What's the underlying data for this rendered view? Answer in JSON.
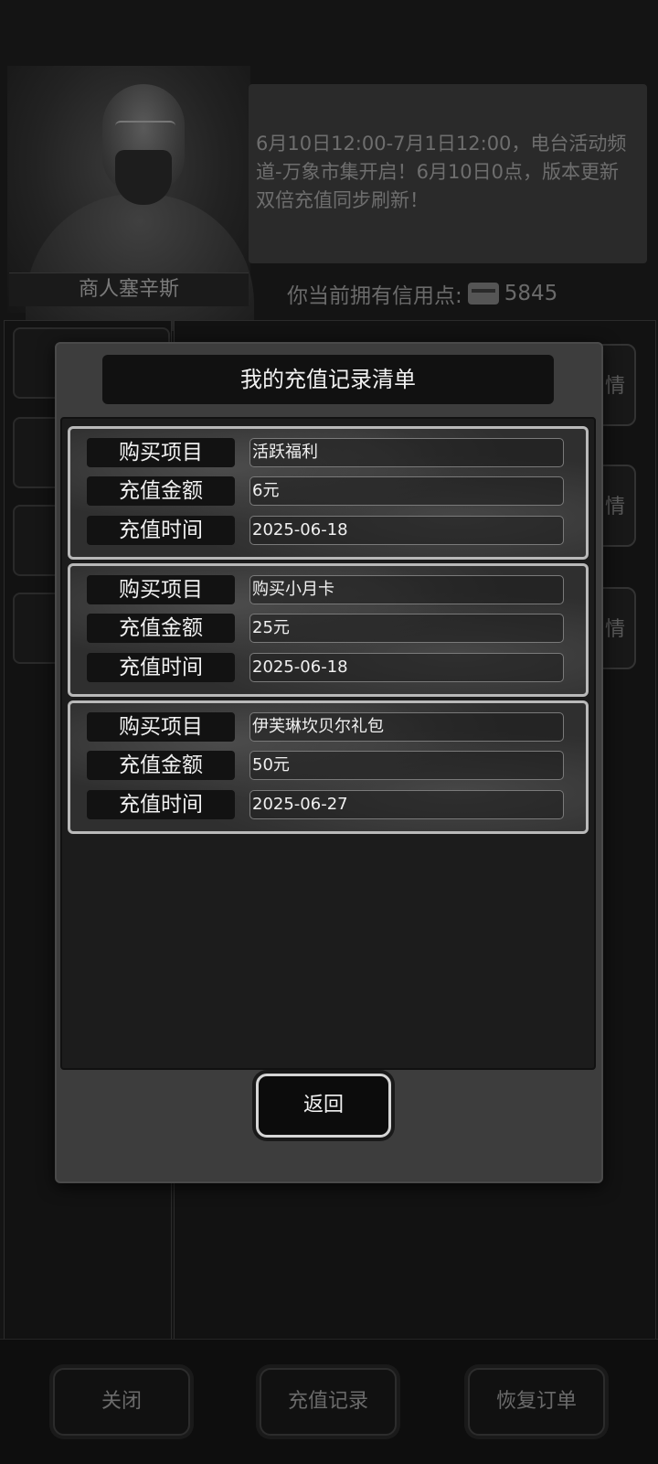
{
  "background": {
    "npc_name": "商人塞辛斯",
    "notice": "6月10日12:00-7月1日12:00，电台活动频道-万象市集开启！6月10日0点，版本更新双倍充值同步刷新！",
    "credits_label": "你当前拥有信用点:",
    "credits_icon": "card-icon",
    "credits_value": "5845",
    "side_buttons": [
      "情",
      "情",
      "情"
    ],
    "bottom_buttons": {
      "close": "关闭",
      "records": "充值记录",
      "restore": "恢复订单"
    }
  },
  "modal": {
    "title": "我的充值记录清单",
    "records": [
      {
        "item_label": "购买项目",
        "item": "活跃福利",
        "amount_label": "充值金额",
        "amount": "6元",
        "time_label": "充值时间",
        "time": "2025-06-18"
      },
      {
        "item_label": "购买项目",
        "item": "购买小月卡",
        "amount_label": "充值金额",
        "amount": "25元",
        "time_label": "充值时间",
        "time": "2025-06-18"
      },
      {
        "item_label": "购买项目",
        "item": "伊芙琳坎贝尔礼包",
        "amount_label": "充值金额",
        "amount": "50元",
        "time_label": "充值时间",
        "time": "2025-06-27"
      }
    ],
    "back_label": "返回"
  }
}
